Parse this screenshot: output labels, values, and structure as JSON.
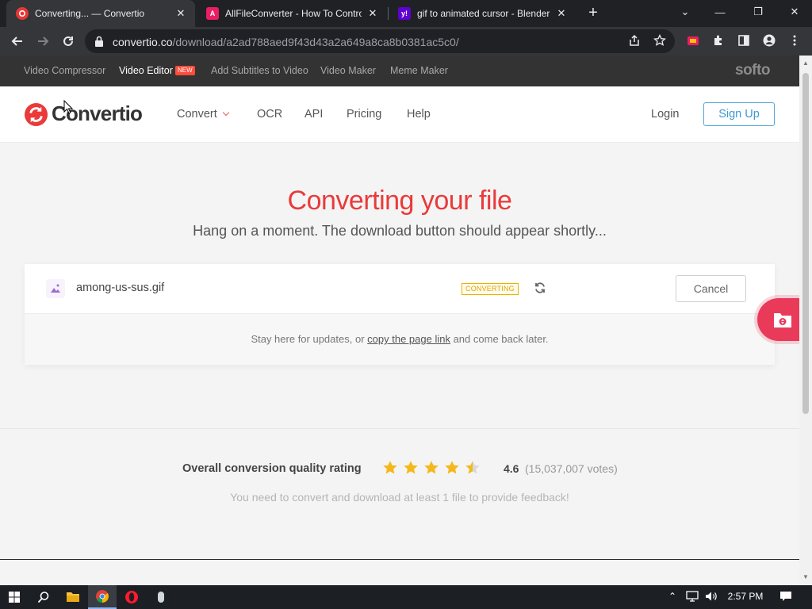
{
  "browser": {
    "tabs": [
      {
        "title": "Converting... — Convertio",
        "active": true,
        "icon": "convertio-favicon",
        "color": "#e53935"
      },
      {
        "title": "AllFileConverter - How To Contro",
        "active": false,
        "icon": "allfileconverter-favicon",
        "color": "#e91e63"
      },
      {
        "title": "gif to animated cursor - Blender",
        "active": false,
        "icon": "yahoo-favicon",
        "color": "#6001d2"
      }
    ],
    "new_tab": "+",
    "window_controls": {
      "minimize": "—",
      "restore": "❐",
      "close": "✕",
      "tab_search": "⌄"
    },
    "url_host": "convertio.co",
    "url_path": "/download/a2ad788aed9f43d43a2a649a8ca8b0381ac5c0/"
  },
  "softo_bar": {
    "links": [
      "Video Compressor",
      "Video Editor",
      "Add Subtitles to Video",
      "Video Maker",
      "Meme Maker"
    ],
    "new_badge": "NEW",
    "brand": "softo"
  },
  "header": {
    "logo": "Convertio",
    "menu": [
      "Convert",
      "OCR",
      "API",
      "Pricing",
      "Help"
    ],
    "login": "Login",
    "signup": "Sign Up",
    "accent": "#ea3a3a"
  },
  "hero": {
    "title": "Converting your file",
    "subtitle": "Hang on a moment. The download button should appear shortly..."
  },
  "file_card": {
    "filename": "among-us-sus.gif",
    "status": "CONVERTING",
    "cancel": "Cancel",
    "footer_before": "Stay here for updates, or",
    "footer_link": "copy the page link",
    "footer_after": "and come back later."
  },
  "rating": {
    "label": "Overall conversion quality rating",
    "value": "4.6",
    "votes": "(15,037,007 votes)",
    "stars_filled": 4.5,
    "stars_total": 5,
    "feedback_note": "You need to convert and download at least 1 file to provide feedback!",
    "star_color": "#f5b81b"
  },
  "taskbar": {
    "time": "2:57 PM"
  }
}
